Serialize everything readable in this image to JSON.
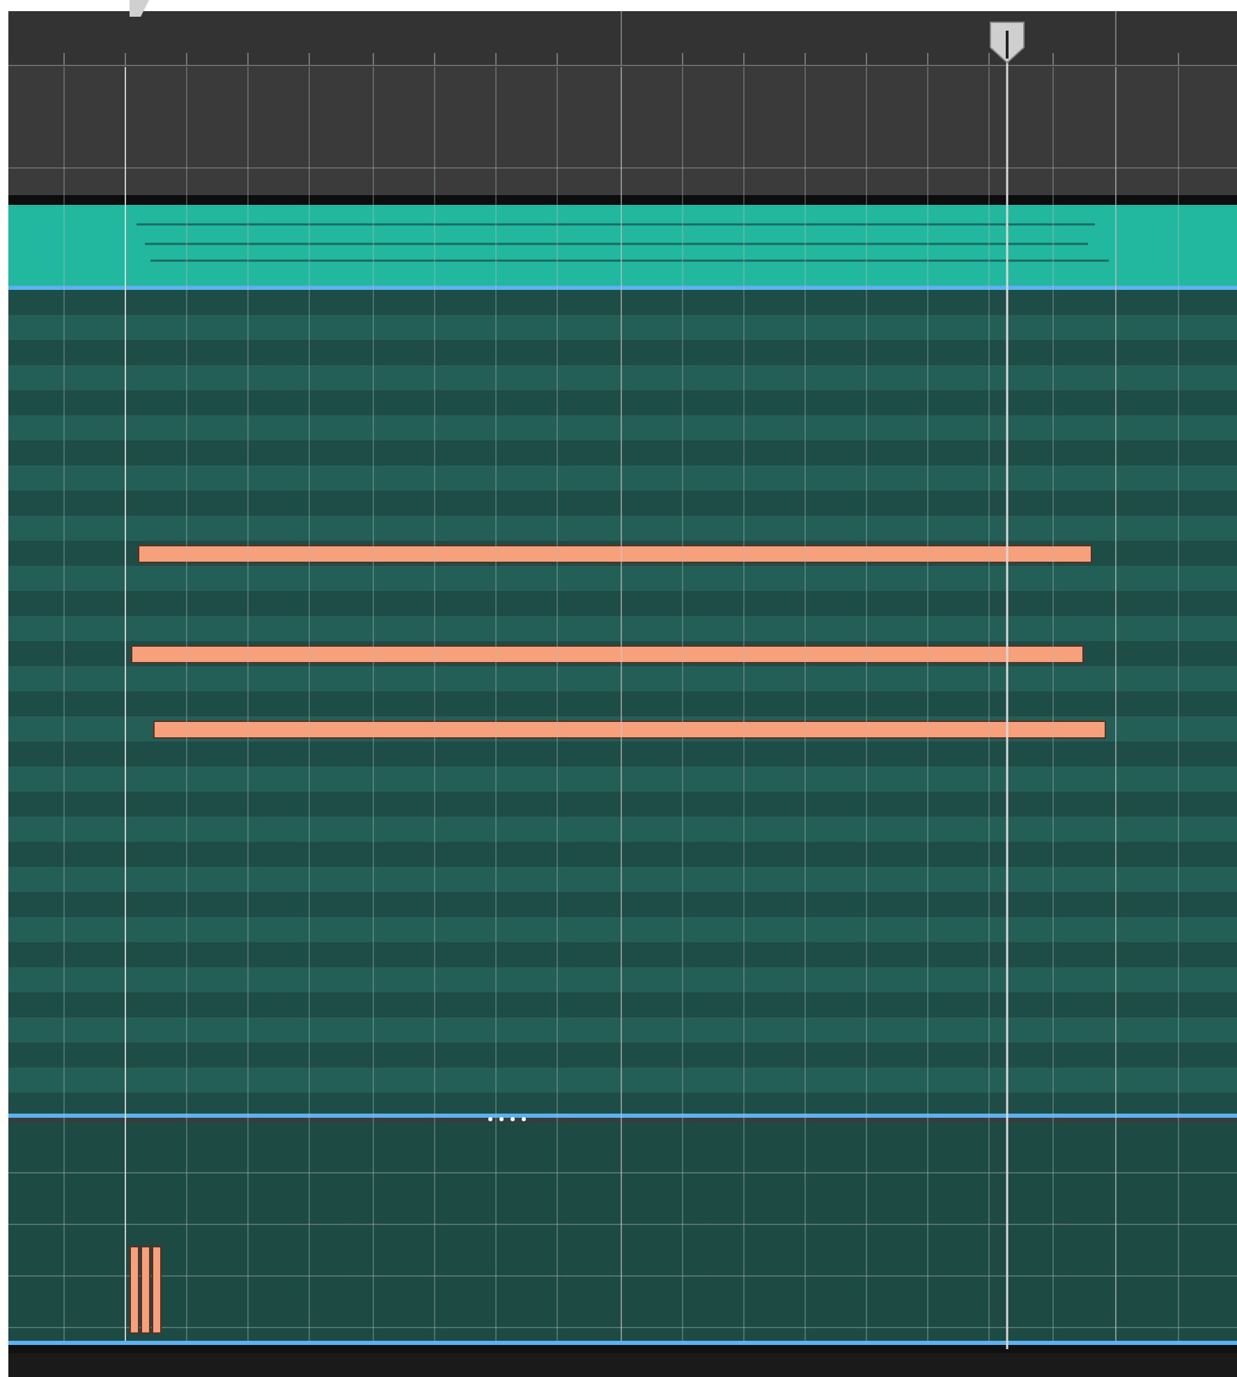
{
  "piano_roll": {
    "notes": [
      {
        "kind": "note"
      },
      {
        "kind": "note"
      },
      {
        "kind": "note"
      }
    ],
    "velocities": [
      {
        "kind": "bar"
      },
      {
        "kind": "bar"
      },
      {
        "kind": "bar"
      }
    ]
  }
}
